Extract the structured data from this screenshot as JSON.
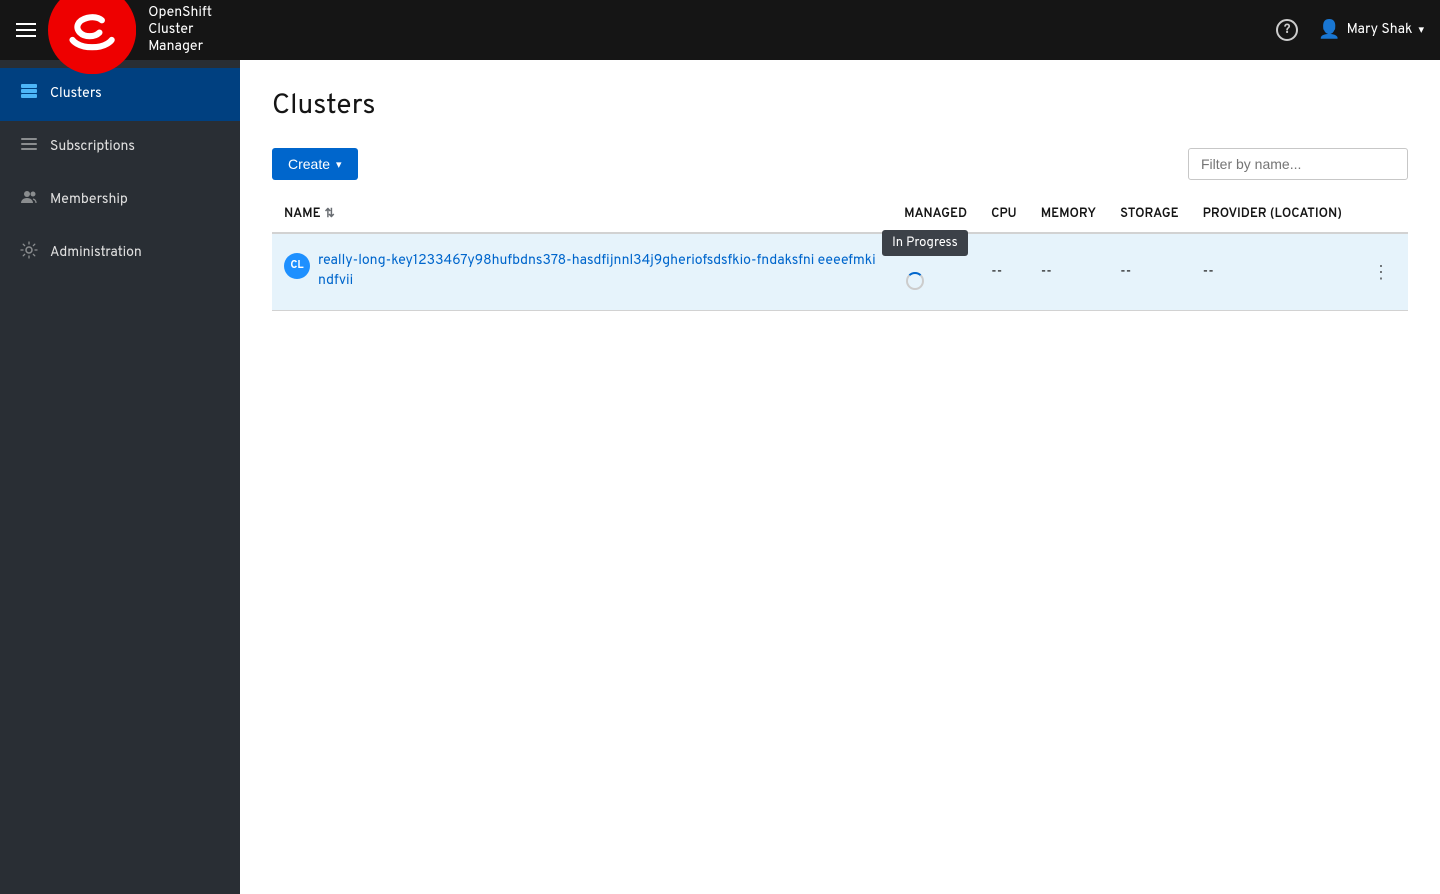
{
  "topnav": {
    "app_name": "OpenShift Cluster Manager",
    "user_name": "Mary Shak",
    "help_label": "?",
    "hamburger_label": "Menu"
  },
  "sidebar": {
    "items": [
      {
        "id": "clusters",
        "label": "Clusters",
        "icon": "🖥",
        "active": true
      },
      {
        "id": "subscriptions",
        "label": "Subscriptions",
        "icon": "☰",
        "active": false
      },
      {
        "id": "membership",
        "label": "Membership",
        "icon": "👥",
        "active": false
      },
      {
        "id": "administration",
        "label": "Administration",
        "icon": "⚙",
        "active": false
      }
    ]
  },
  "main": {
    "page_title": "Clusters",
    "create_button": "Create",
    "filter_placeholder": "Filter by name...",
    "table": {
      "columns": [
        "NAME",
        "MANAGED",
        "CPU",
        "MEMORY",
        "STORAGE",
        "PROVIDER (LOCATION)"
      ],
      "rows": [
        {
          "badge": "CL",
          "name": "really-long-key1233467y98hufbdns378-hasdfijnnl34j9gheriofsdsfkio-fndaksfni eeeefmkindfvii",
          "status": "In Progress",
          "managed": "--",
          "cpu": "--",
          "memory": "--",
          "storage": "--",
          "provider": ""
        }
      ]
    }
  }
}
